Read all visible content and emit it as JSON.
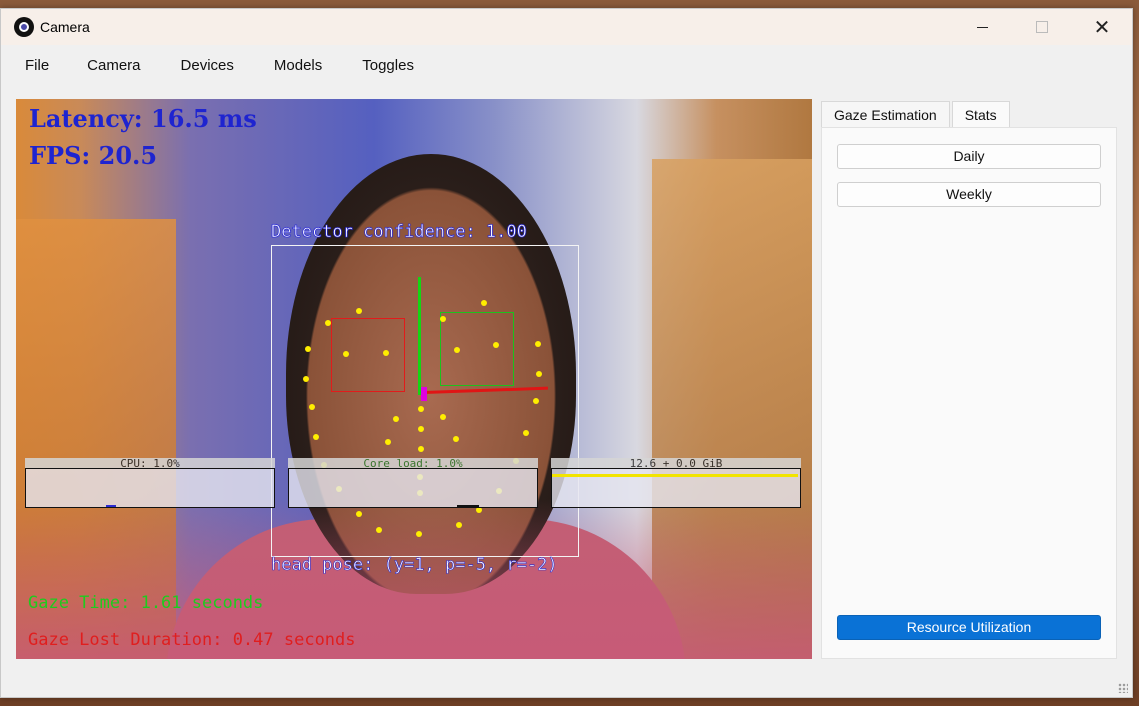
{
  "window": {
    "title": "Camera",
    "icon": "camera-app-icon",
    "controls": [
      "minimize-icon",
      "maximize-icon",
      "close-icon"
    ]
  },
  "menu": {
    "items": [
      "File",
      "Camera",
      "Devices",
      "Models",
      "Toggles"
    ]
  },
  "video": {
    "latency": "Latency: 16.5 ms",
    "fps": "FPS: 20.5",
    "detector_confidence": "Detector confidence: 1.00",
    "head_pose": "head pose: (y=1, p=-5, r=-2)",
    "gaze_time": "Gaze Time: 1.61 seconds",
    "gaze_lost": "Gaze Lost Duration: 0.47 seconds",
    "meters": [
      {
        "label": "CPU: 1.0%",
        "fraction": 0.04
      },
      {
        "label": "Core load: 1.0%",
        "fraction": 0.09
      },
      {
        "label": "12.6 + 0.0 GiB",
        "fraction": 1.0
      }
    ],
    "colors": {
      "latency": "#1e24d0",
      "gaze_time": "#1ecb1e",
      "gaze_lost": "#e01e1e",
      "landmark": "#ffee00"
    }
  },
  "sidepanel": {
    "tabs": [
      "Gaze Estimation",
      "Stats"
    ],
    "active_tab": "Stats",
    "buttons": {
      "daily": "Daily",
      "weekly": "Weekly",
      "resource": "Resource Utilization"
    },
    "accent": "#0a72d6"
  }
}
